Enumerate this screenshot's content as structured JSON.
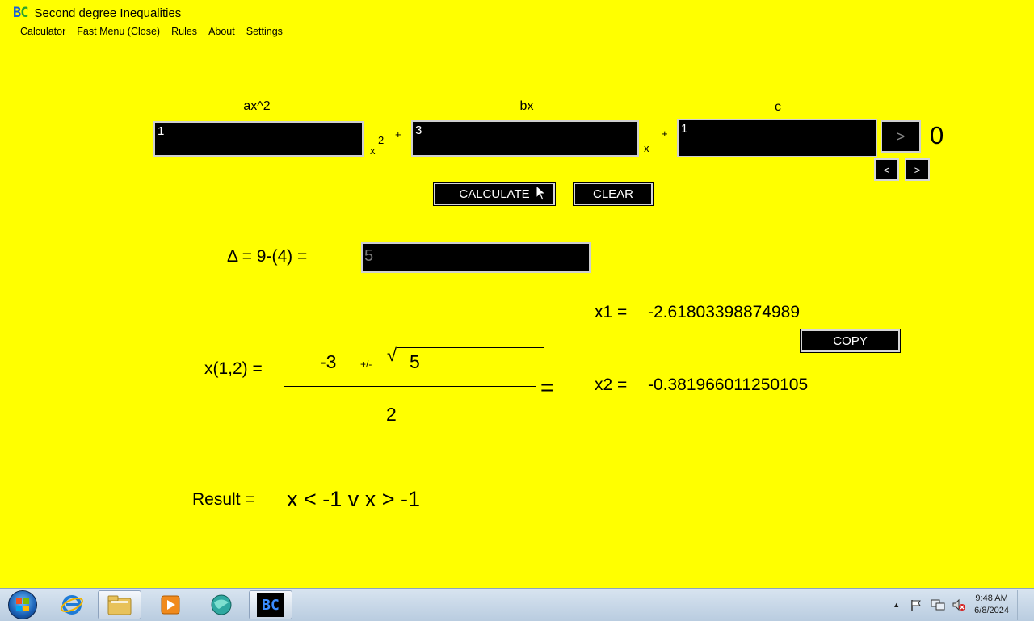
{
  "app": {
    "logo_b": "B",
    "logo_c": "C",
    "title": "Second degree Inequalities"
  },
  "menu": {
    "calculator": "Calculator",
    "fast_menu": "Fast Menu (Close)",
    "rules": "Rules",
    "about": "About",
    "settings": "Settings"
  },
  "coefficients": {
    "a_label": "ax^2",
    "b_label": "bx",
    "c_label": "c",
    "a_value": "1",
    "b_value": "3",
    "c_value": "1",
    "x_symbol": "x",
    "exp_symbol": "2",
    "plus1": "+",
    "plus2": "+",
    "x_symbol2": "x"
  },
  "inequality": {
    "toggle_label": ">",
    "rhs": "0",
    "prev_label": "<",
    "next_label": ">"
  },
  "buttons": {
    "calculate": "CALCULATE",
    "clear": "CLEAR",
    "copy": "COPY"
  },
  "delta": {
    "label": "Δ = 9-(4) =",
    "value": "5"
  },
  "formula": {
    "label": "x(1,2) =",
    "neg_b": "-3",
    "plus_minus": "+/-",
    "sqrt_symbol": "√",
    "sqrt_value": "5",
    "denominator": "2",
    "equals": "="
  },
  "roots": {
    "x1_label": "x1 =",
    "x1_value": "-2.61803398874989",
    "x2_label": "x2 =",
    "x2_value": "-0.381966011250105"
  },
  "result": {
    "label": "Result =",
    "value": "x < -1 v x > -1"
  },
  "taskbar": {
    "time": "9:48 AM",
    "date": "6/8/2024",
    "bc_label": "BC"
  }
}
